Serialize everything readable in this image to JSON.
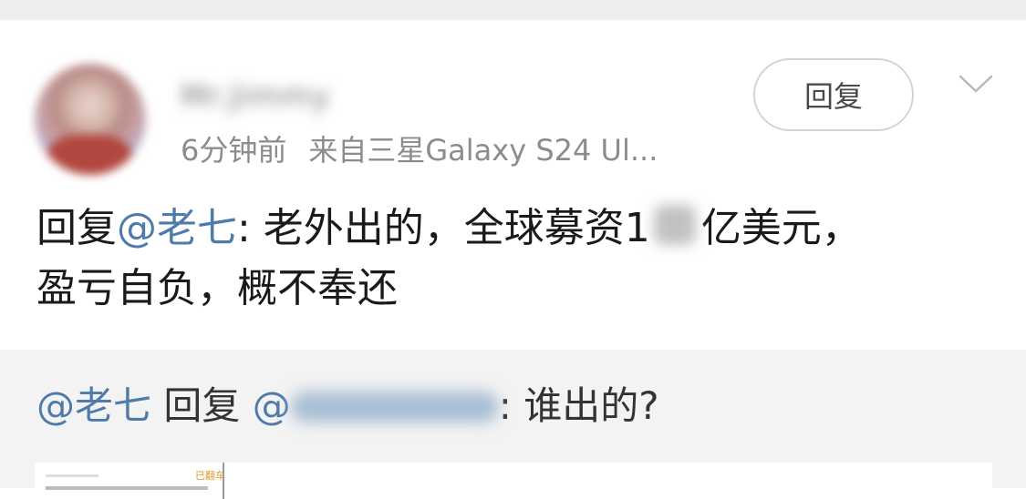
{
  "comment": {
    "author": "Mr.Jimmy",
    "time": "6分钟前",
    "source": "来自三星Galaxy S24 Ul...",
    "reply_button": "回复",
    "body": {
      "prefix": "回复",
      "mention": "@老七",
      "line1": ": 老外出的，全球募资1",
      "line1_end": "亿美元，",
      "line2": "盈亏自负，概不奉还"
    }
  },
  "quoted": {
    "mention": "@老七",
    "reply_word": " 回复 ",
    "at": "@",
    "text": ": 谁出的?",
    "thumb_tag": "已翻车"
  },
  "icons": {
    "expand": "chevron-down-icon"
  }
}
